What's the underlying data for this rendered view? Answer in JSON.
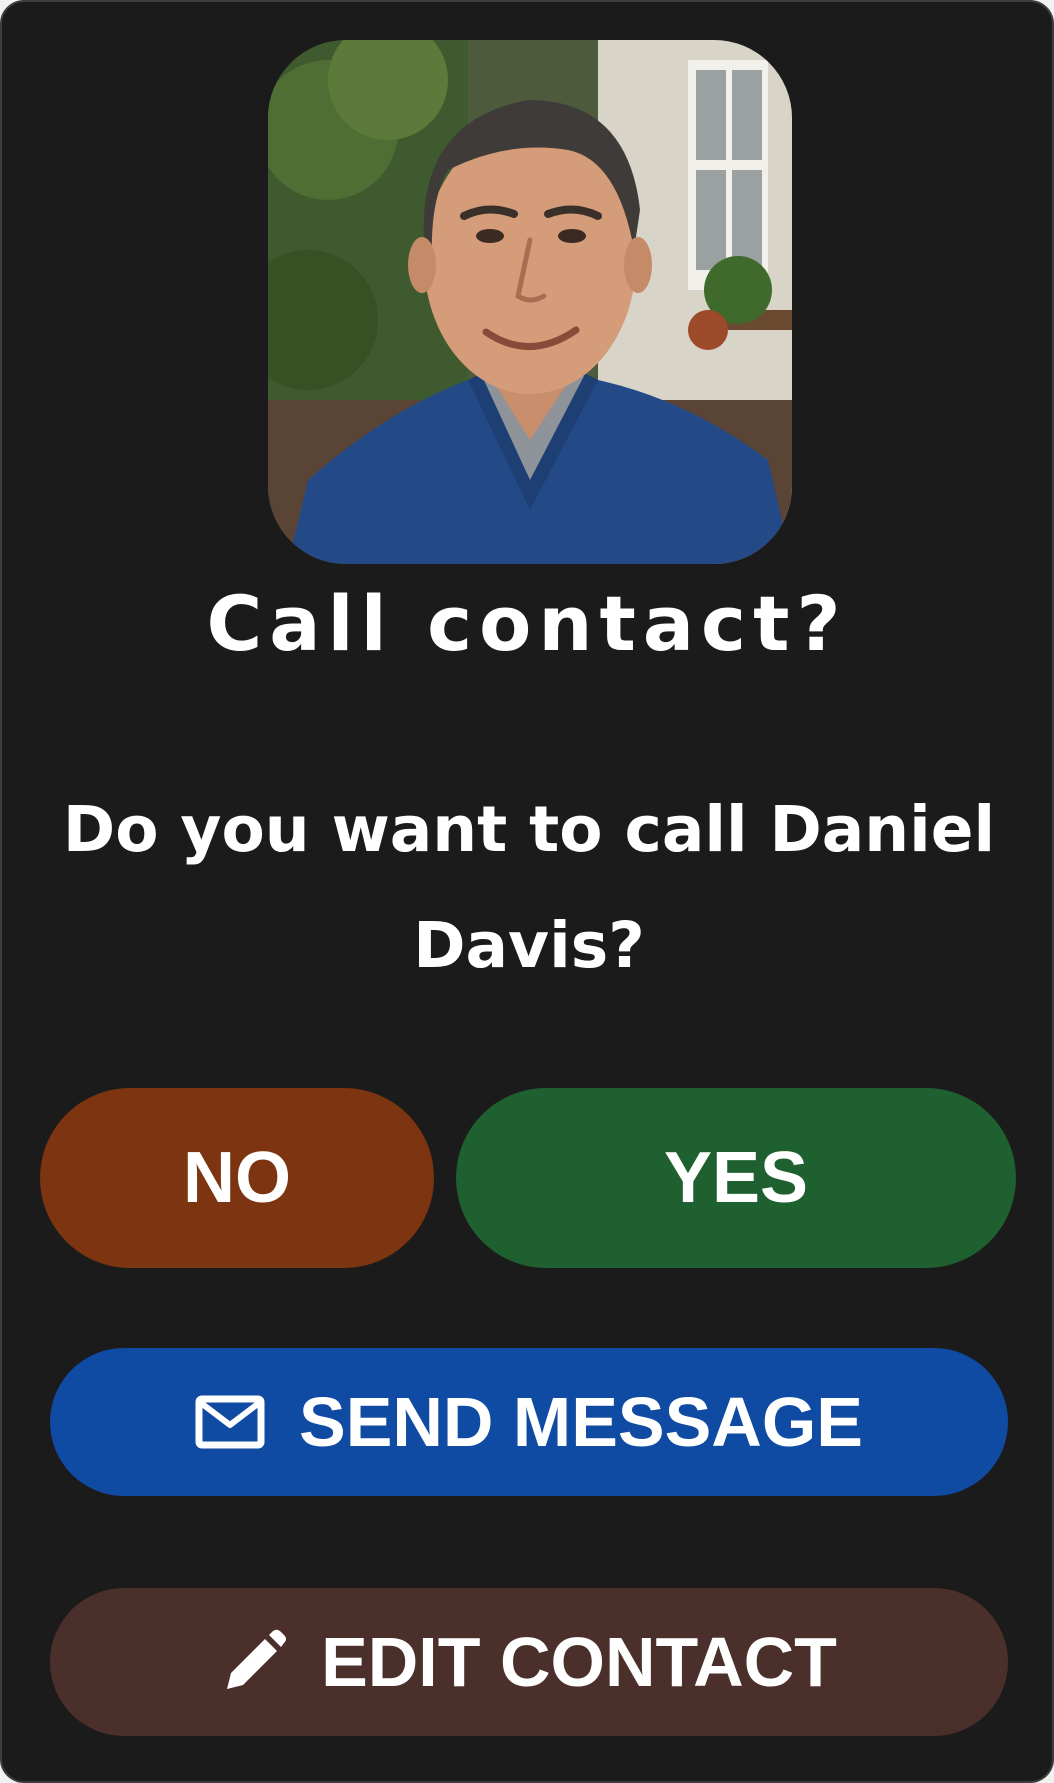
{
  "dialog": {
    "title": "Call contact?",
    "message": "Do you want to call Daniel Davis?"
  },
  "buttons": {
    "no_label": "NO",
    "yes_label": "YES",
    "send_message_label": "SEND MESSAGE",
    "edit_contact_label": "EDIT CONTACT"
  },
  "icons": {
    "send_message": "envelope-icon",
    "edit_contact": "pencil-icon"
  },
  "colors": {
    "background": "#1b1b1c",
    "no_button": "#7c3510",
    "yes_button": "#1f6030",
    "send_message_button": "#0f4aa3",
    "edit_contact_button": "#4b2f2a"
  }
}
